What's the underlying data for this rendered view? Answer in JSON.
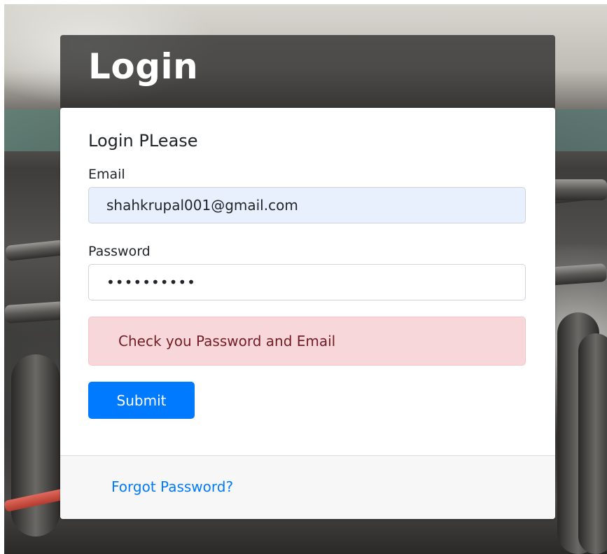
{
  "header": {
    "title": "Login"
  },
  "form": {
    "heading": "Login PLease",
    "email_label": "Email",
    "email_value": "shahkrupal001@gmail.com",
    "password_label": "Password",
    "password_value": "••••••••••",
    "error_message": "Check you Password and Email",
    "submit_label": "Submit"
  },
  "footer": {
    "forgot_password_label": "Forgot Password?"
  },
  "colors": {
    "primary": "#007bff",
    "alert_background": "#f8d7da",
    "alert_text": "#721c24",
    "autofill_background": "#e8f0fe"
  }
}
